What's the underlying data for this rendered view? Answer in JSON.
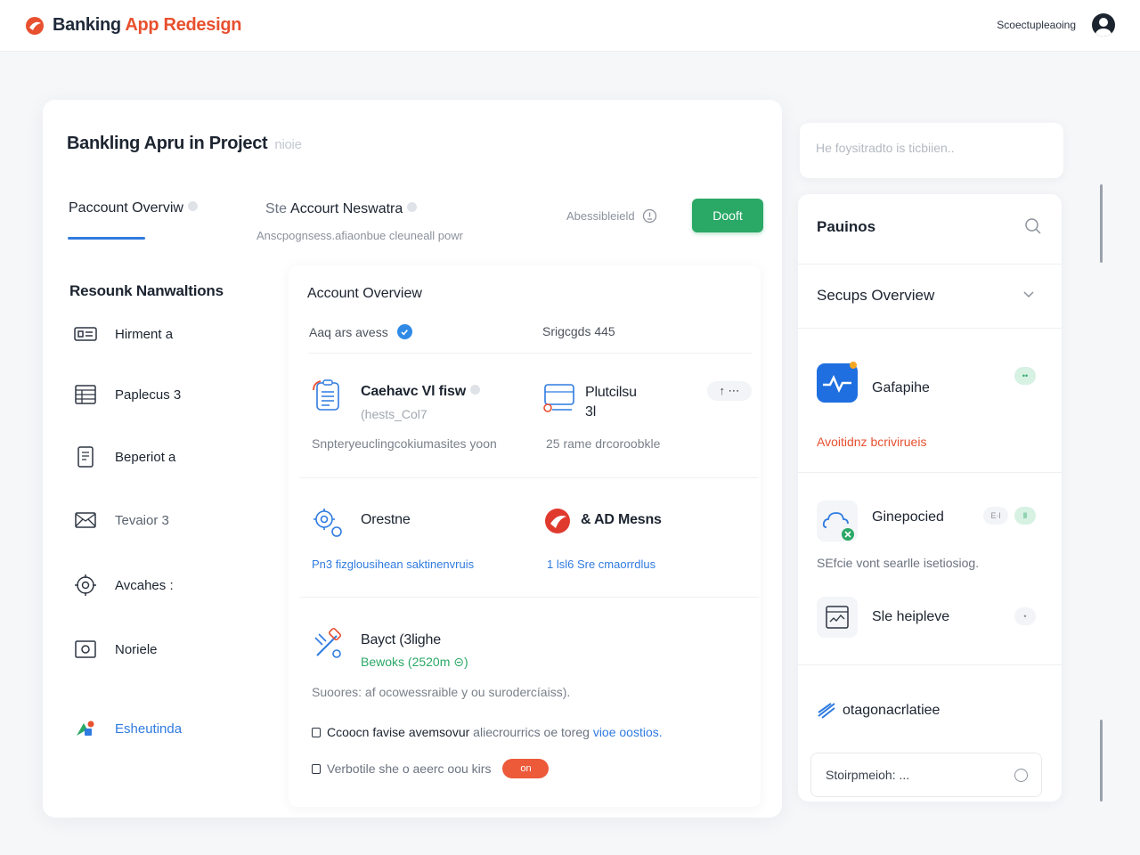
{
  "header": {
    "brand_part1": "Banking ",
    "brand_part2": "App Redesign",
    "top_link": "Scoectupleaoing",
    "accent_color": "#e8502f"
  },
  "page": {
    "title": "Bankling Apru in Project",
    "title_suffix": "nioie",
    "tab_active": "Paccount Overviw",
    "tab2_prefix": "Ste",
    "tab2_label": "Accourt Neswatra",
    "tab2_subtitle": "Anscpognsess.afiaonbue cleuneall powr",
    "access_label": "Abessibleield",
    "primary_button": "Dooft",
    "primary_color": "#2aa866"
  },
  "nav": {
    "heading": "Resounk Nanwaltions",
    "items": [
      {
        "label": "Hirment",
        "count": "a",
        "icon": "card-list-icon"
      },
      {
        "label": "Paplecus",
        "count": "3",
        "icon": "spreadsheet-icon"
      },
      {
        "label": "Beperiot",
        "count": "a",
        "icon": "document-icon"
      },
      {
        "label": "Tevaior",
        "count": "3",
        "icon": "envelope-icon"
      },
      {
        "label": "Avcahes",
        "count": ":",
        "icon": "gear-refresh-icon"
      },
      {
        "label": "Noriele",
        "count": "",
        "icon": "frame-icon"
      },
      {
        "label": "Esheutinda",
        "count": "",
        "icon": "shapes-icon"
      }
    ]
  },
  "overview": {
    "title": "Account Overview",
    "row1_left": "Aaq ars avess",
    "row1_right": "Srigcgds 445",
    "feature1": {
      "title": "Caehavc Vl fisw",
      "sub": "(hests_Col7",
      "desc": "Snpteryeuclingcokiumasites yoon"
    },
    "feature2": {
      "title": "Plutcilsu",
      "num": "3l",
      "desc": "25 rame drcoroobkle",
      "tools": "↑ ⋯"
    },
    "feature3": {
      "title": "Orestne",
      "link": "Pn3 fizglousihean saktinenvruis"
    },
    "feature4": {
      "title": "& AD Mesns",
      "link": "1 lsl6 Sre cmaorrdlus"
    },
    "feature5": {
      "title": "Bayct (3lighe",
      "green": "Bewoks (2520m ⊝)",
      "desc": "Suoores: af ocowessraible y ou surodercíaiss)."
    },
    "check1": {
      "a": "Ccoocn favise avemsovur",
      "b": " aliecrourrics oe toreg ",
      "c": "vioe oostios."
    },
    "check2": {
      "label": "Verbotile she o aeerc oou kirs",
      "toggle": "on"
    }
  },
  "right": {
    "search_placeholder": "He foysitradto is ticbiien..",
    "heading1": "Pauinos",
    "heading2": "Secups Overview",
    "app1": {
      "label": "Gafapihe",
      "pill": "••"
    },
    "red_text": "Avoitidnz bcrivirueis",
    "app2": {
      "label": "Ginepocied",
      "pill1": "E·l",
      "pill2": "ll"
    },
    "desc": "SEfcie vont searlle isetiosiog.",
    "app3": {
      "label": "Sle heipleve",
      "pill": "•"
    },
    "brand_label": "otagonacrlatiee",
    "bottom_placeholder": "Stoirpmeioh: ..."
  }
}
